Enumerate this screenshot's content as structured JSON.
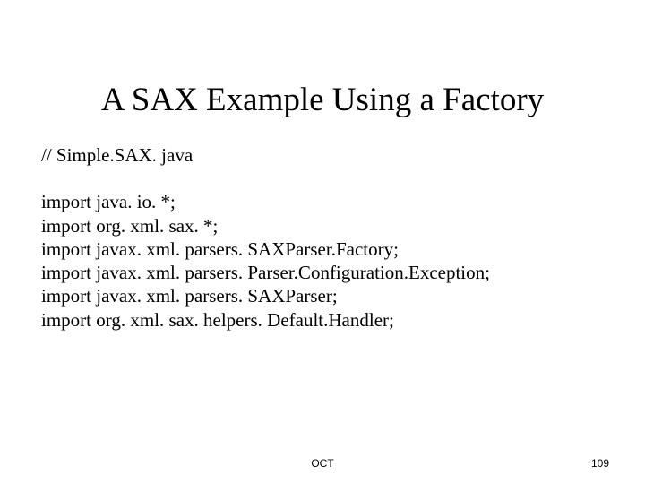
{
  "title": "A SAX Example Using a Factory",
  "code": {
    "comment": "// Simple.SAX. java",
    "imports": [
      "import java. io. *;",
      "import org. xml. sax. *;",
      "import javax. xml. parsers. SAXParser.Factory;",
      "import javax. xml. parsers. Parser.Configuration.Exception;",
      "import javax. xml. parsers. SAXParser;",
      "import org. xml. sax. helpers. Default.Handler;"
    ]
  },
  "footer": {
    "center": "OCT",
    "page_number": "109"
  }
}
